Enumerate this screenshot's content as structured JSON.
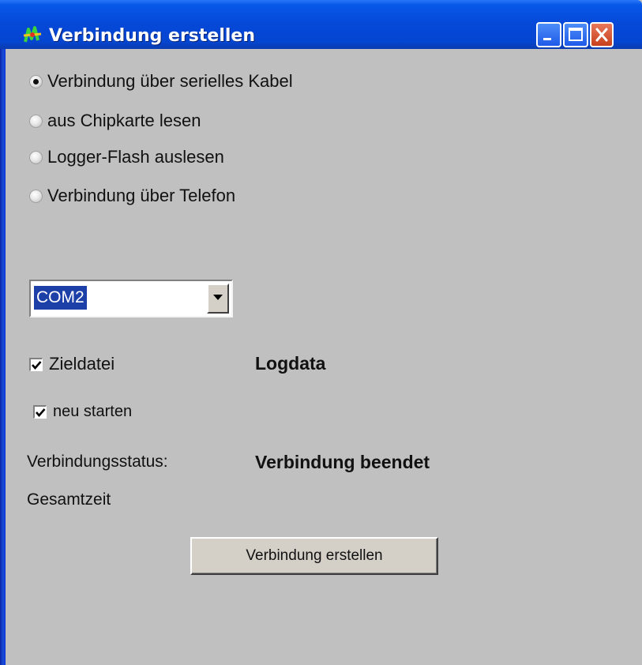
{
  "window": {
    "title": "Verbindung erstellen",
    "colors": {
      "titlebar": "#0548d8",
      "background": "#c0c0c0",
      "close_button": "#d84a24"
    }
  },
  "connection_options": [
    {
      "label": "Verbindung über serielles Kabel",
      "checked": true
    },
    {
      "label": "aus Chipkarte lesen",
      "checked": false
    },
    {
      "label": "Logger-Flash auslesen",
      "checked": false
    },
    {
      "label": "Verbindung über Telefon",
      "checked": false
    }
  ],
  "port_select": {
    "value": "COM2"
  },
  "target_file": {
    "label": "Zieldatei",
    "checked": true,
    "value": "Logdata"
  },
  "restart": {
    "label": "neu starten",
    "checked": true
  },
  "status": {
    "label": "Verbindungsstatus:",
    "value": "Verbindung beendet"
  },
  "total_time": {
    "label": "Gesamtzeit"
  },
  "connect_button": {
    "label": "Verbindung erstellen"
  }
}
